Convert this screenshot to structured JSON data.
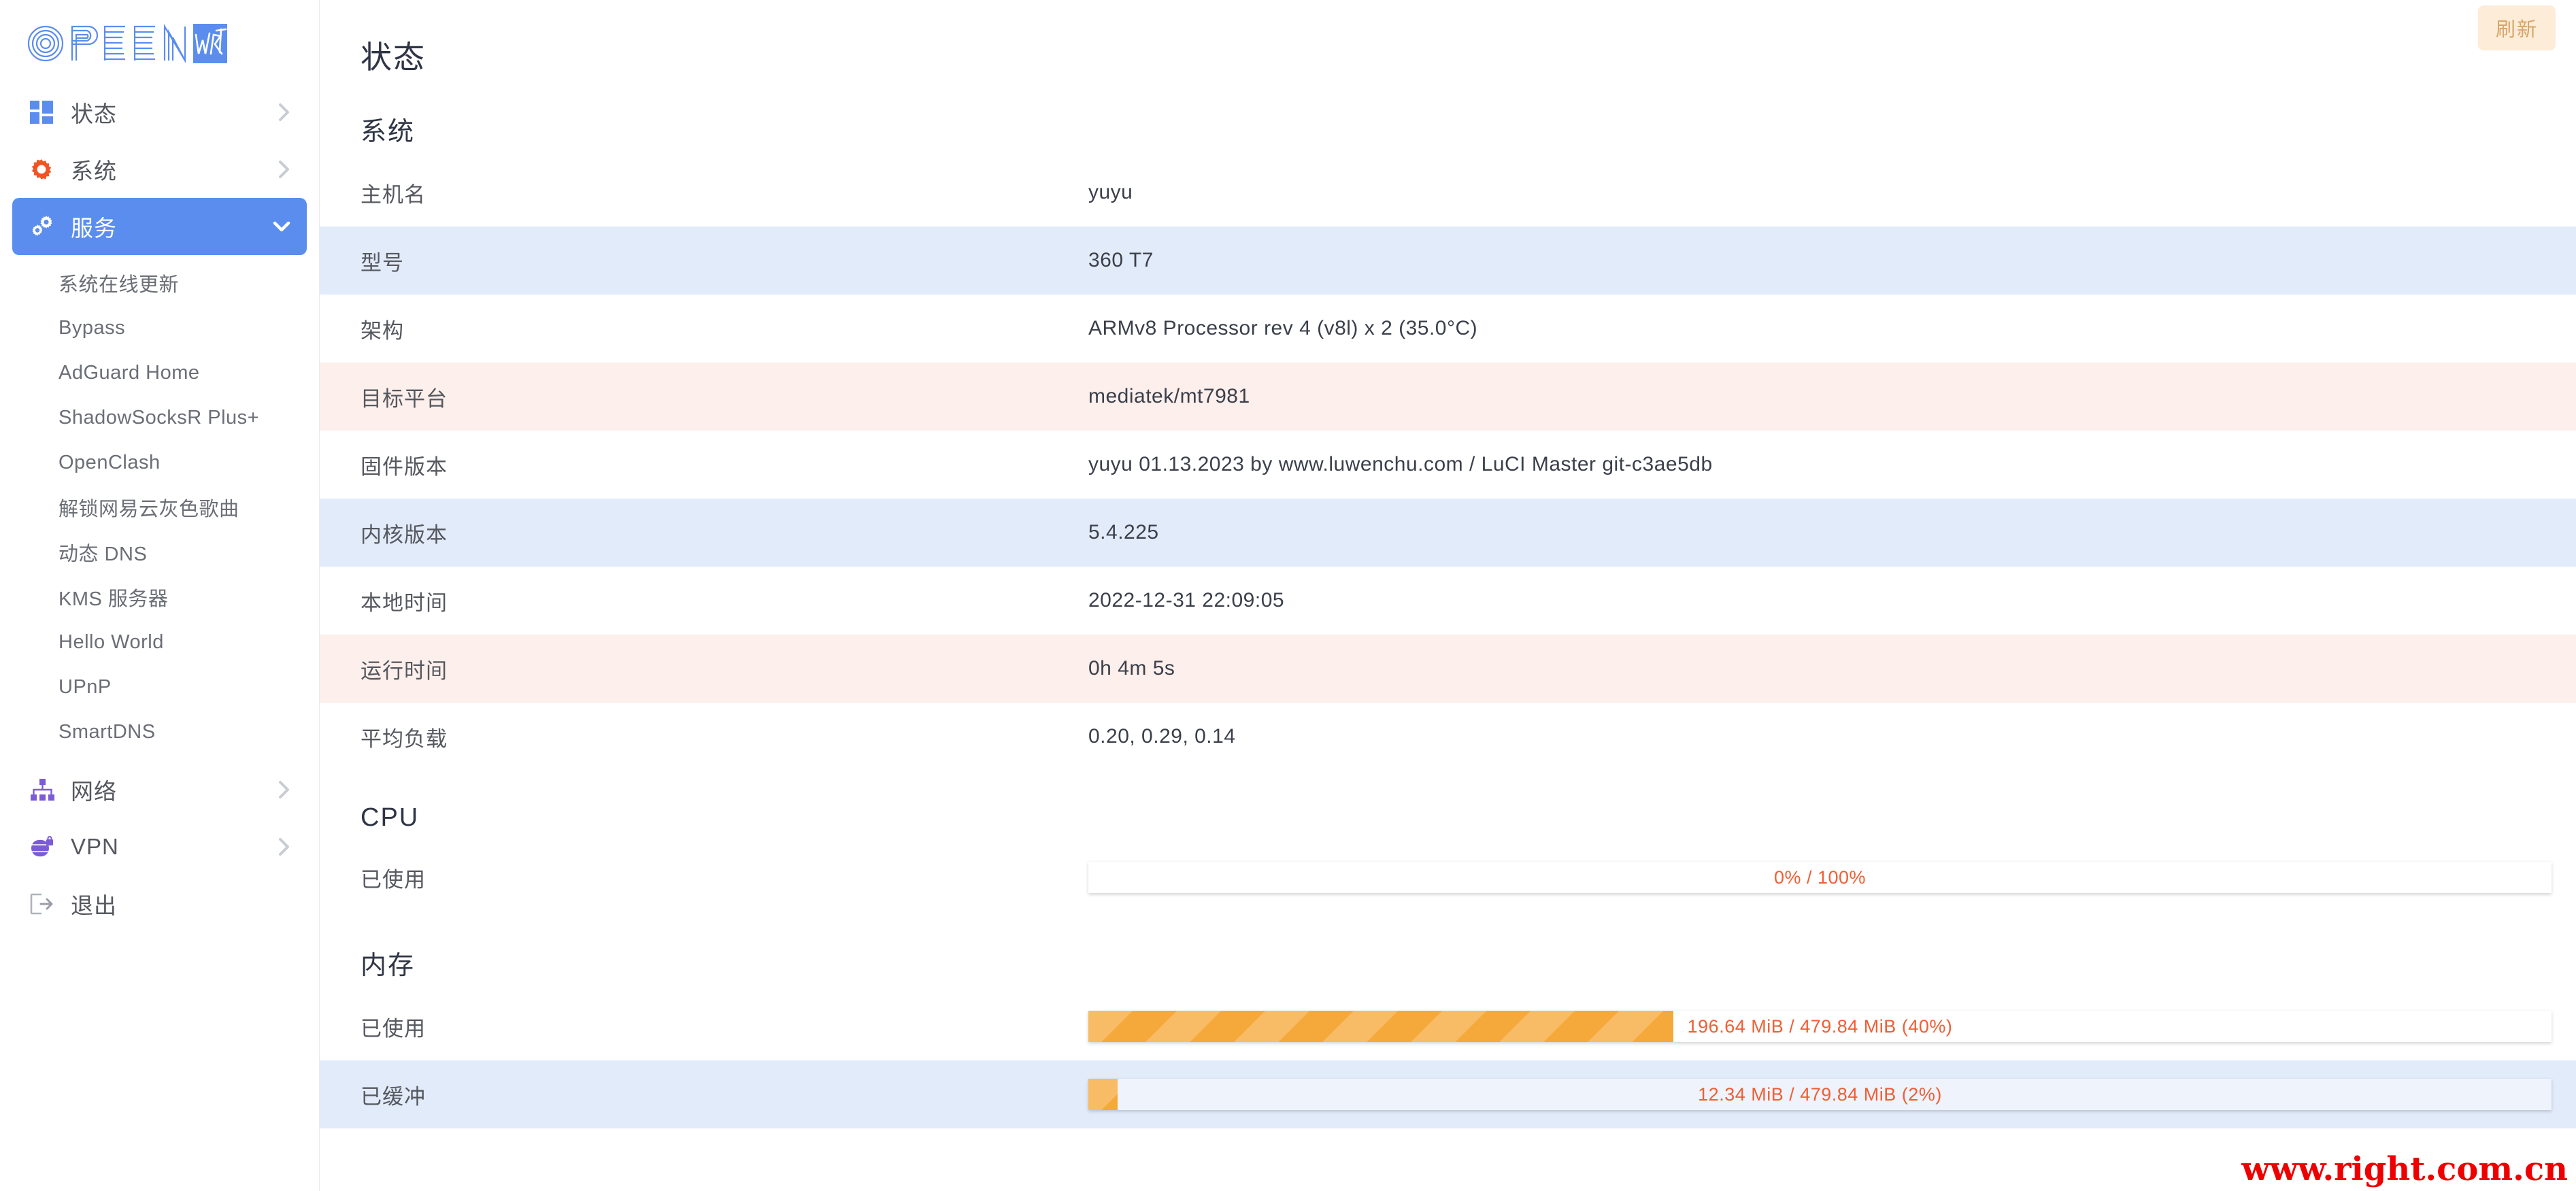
{
  "brand": {
    "open_text": "OPEN",
    "wrt_text": "WRT",
    "logo_blue": "#5b8def"
  },
  "sidebar": {
    "items": [
      {
        "label": "状态",
        "icon": "grid-icon",
        "active": false,
        "chevron": "chevron-right-icon"
      },
      {
        "label": "系统",
        "icon": "gear-icon",
        "active": false,
        "chevron": "chevron-right-icon"
      },
      {
        "label": "服务",
        "icon": "gears-icon",
        "active": true,
        "chevron": "chevron-down-icon"
      },
      {
        "label": "网络",
        "icon": "sitemap-icon",
        "active": false,
        "chevron": "chevron-right-icon"
      },
      {
        "label": "VPN",
        "icon": "globe-lock-icon",
        "active": false,
        "chevron": "chevron-right-icon"
      },
      {
        "label": "退出",
        "icon": "logout-icon",
        "active": false,
        "chevron": ""
      }
    ],
    "services_submenu": [
      {
        "label": "系统在线更新"
      },
      {
        "label": "Bypass"
      },
      {
        "label": "AdGuard Home"
      },
      {
        "label": "ShadowSocksR Plus+"
      },
      {
        "label": "OpenClash"
      },
      {
        "label": "解锁网易云灰色歌曲"
      },
      {
        "label": "动态 DNS"
      },
      {
        "label": "KMS 服务器"
      },
      {
        "label": "Hello World"
      },
      {
        "label": "UPnP"
      },
      {
        "label": "SmartDNS"
      }
    ]
  },
  "main": {
    "refresh_label": "刷新",
    "page_title": "状态",
    "sections": {
      "system": {
        "title": "系统",
        "rows": [
          {
            "label": "主机名",
            "value": "yuyu",
            "bg": "plain"
          },
          {
            "label": "型号",
            "value": "360 T7",
            "bg": "alt-blue"
          },
          {
            "label": "架构",
            "value": "ARMv8 Processor rev 4 (v8l) x 2 (35.0°C)",
            "bg": "plain"
          },
          {
            "label": "目标平台",
            "value": "mediatek/mt7981",
            "bg": "alt-pink"
          },
          {
            "label": "固件版本",
            "value": "yuyu 01.13.2023 by www.luwenchu.com / LuCI Master git-c3ae5db",
            "bg": "plain"
          },
          {
            "label": "内核版本",
            "value": "5.4.225",
            "bg": "alt-blue"
          },
          {
            "label": "本地时间",
            "value": "2022-12-31 22:09:05",
            "bg": "plain"
          },
          {
            "label": "运行时间",
            "value": "0h 4m 5s",
            "bg": "alt-pink"
          },
          {
            "label": "平均负载",
            "value": "0.20, 0.29, 0.14",
            "bg": "plain"
          }
        ]
      },
      "cpu": {
        "title": "CPU",
        "rows": [
          {
            "label": "已使用",
            "bar_text": "0% / 100%",
            "percent": 0,
            "bg": "plain"
          }
        ]
      },
      "memory": {
        "title": "内存",
        "rows": [
          {
            "label": "已使用",
            "bar_text": "196.64 MiB / 479.84 MiB (40%)",
            "percent": 40,
            "bg": "plain"
          },
          {
            "label": "已缓冲",
            "bar_text": "12.34 MiB / 479.84 MiB (2%)",
            "percent": 2,
            "bg": "alt-blue"
          }
        ]
      }
    }
  },
  "watermark": {
    "text": "www.right.com.cn",
    "color": "#ee0000"
  }
}
